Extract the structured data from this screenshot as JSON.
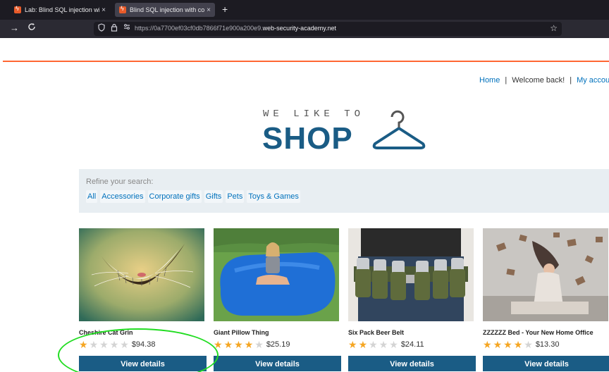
{
  "browser": {
    "tabs": [
      {
        "title": "Lab: Blind SQL injection with co",
        "close": "×"
      },
      {
        "title": "Blind SQL injection with conditi",
        "close": "×"
      }
    ],
    "new_tab": "+",
    "nav": {
      "forward": "→",
      "reload": "C"
    },
    "url": {
      "prefix": "https://0a7700ef03cf0db7866f71e900a200e9.",
      "host": "web-security-academy.net"
    }
  },
  "header": {
    "nav": {
      "home": "Home",
      "separator": "|",
      "welcome": "Welcome back!",
      "account": "My accoun"
    }
  },
  "logo": {
    "tagline": "WE LIKE TO",
    "word": "SHOP"
  },
  "search": {
    "refine_label": "Refine your search:",
    "filters": [
      "All",
      "Accessories",
      "Corporate gifts",
      "Gifts",
      "Pets",
      "Toys & Games"
    ]
  },
  "products": [
    {
      "name": "Cheshire Cat Grin",
      "stars": 1,
      "price": "$94.38",
      "button": "View details"
    },
    {
      "name": "Giant Pillow Thing",
      "stars": 4,
      "price": "$25.19",
      "button": "View details"
    },
    {
      "name": "Six Pack Beer Belt",
      "stars": 2,
      "price": "$24.11",
      "button": "View details"
    },
    {
      "name": "ZZZZZZ Bed - Your New Home Office",
      "stars": 4,
      "price": "$13.30",
      "button": "View details"
    }
  ],
  "colors": {
    "accent_orange": "#ff6633",
    "brand_blue": "#1a5c85",
    "link_blue": "#0071bc",
    "star_gold": "#f5a623",
    "annotation_green": "#22dd22"
  }
}
